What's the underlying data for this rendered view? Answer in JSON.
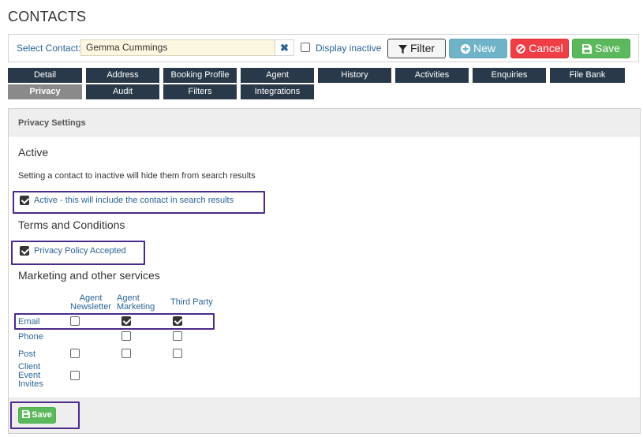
{
  "page": {
    "title": "CONTACTS"
  },
  "toolbar": {
    "select_label": "Select Contact:",
    "contact_value": "Gemma Cummings",
    "clear_glyph": "✖",
    "display_inactive_label": "Display inactive",
    "display_inactive_checked": false,
    "buttons": {
      "filter": "Filter",
      "new": "New",
      "cancel": "Cancel",
      "save": "Save"
    }
  },
  "tabs": [
    {
      "label": "Detail"
    },
    {
      "label": "Address"
    },
    {
      "label": "Booking Profile"
    },
    {
      "label": "Agent"
    },
    {
      "label": "History"
    },
    {
      "label": "Activities"
    },
    {
      "label": "Enquiries"
    },
    {
      "label": "File Bank"
    },
    {
      "label": "Privacy",
      "active": true
    },
    {
      "label": "Audit"
    },
    {
      "label": "Filters"
    },
    {
      "label": "Integrations"
    }
  ],
  "panel": {
    "title": "Privacy Settings",
    "active_section": {
      "heading": "Active",
      "description": "Setting a contact to inactive will hide them from search results",
      "checkbox_label": "Active - this will include the contact in search results",
      "checked": true
    },
    "terms_section": {
      "heading": "Terms and Conditions",
      "checkbox_label": "Privacy Policy Accepted",
      "checked": true
    },
    "marketing_section": {
      "heading": "Marketing and other services",
      "columns": {
        "agent_newsletter_1": "Agent",
        "agent_newsletter_2": "Newsletter",
        "agent_marketing_1": "Agent",
        "agent_marketing_2": "Marketing",
        "third_party": "Third Party"
      },
      "rows": [
        {
          "label": "Email",
          "agent_newsletter": false,
          "agent_marketing": true,
          "third_party": true
        },
        {
          "label": "Phone",
          "agent_marketing": false,
          "third_party": false
        },
        {
          "label": "Post",
          "agent_newsletter": false,
          "agent_marketing": false,
          "third_party": false
        },
        {
          "label_1": "Client",
          "label_2": "Event",
          "label_3": "Invites",
          "agent_newsletter": false
        }
      ]
    },
    "save_label": "Save"
  },
  "colors": {
    "tab_bg": "#29394a",
    "tab_active_bg": "#8a8a8a",
    "link": "#2a6496",
    "highlight": "#4b2a8c",
    "save_green": "#5cb85c",
    "cancel_red": "#ef3e45",
    "new_blue": "#6fb3c9"
  }
}
